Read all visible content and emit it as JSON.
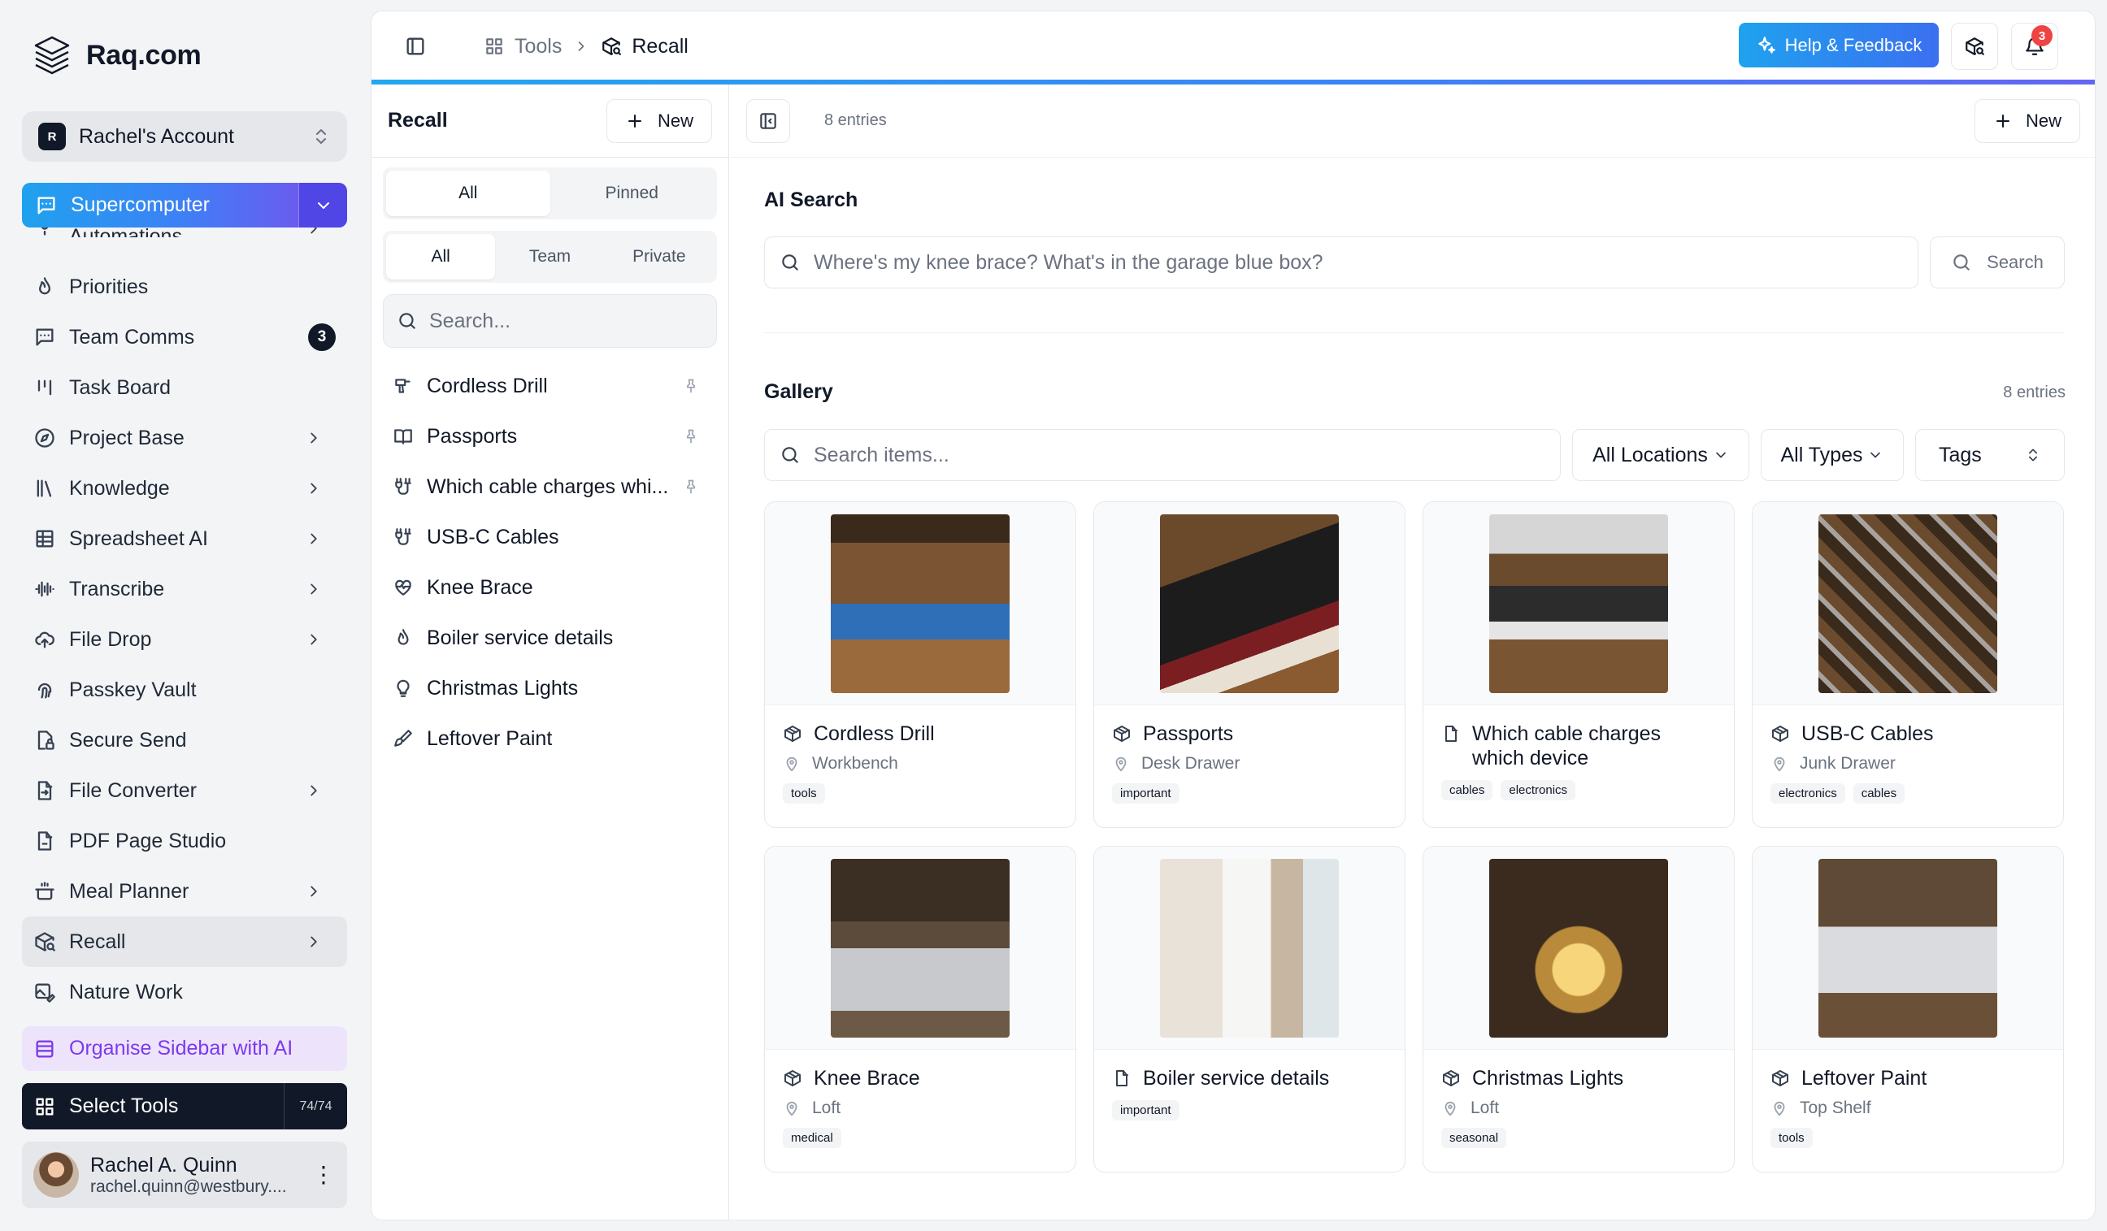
{
  "brand": {
    "name": "Raq.com"
  },
  "account": {
    "badge": "R",
    "name": "Rachel's Account"
  },
  "supercomputer": {
    "label": "Supercomputer"
  },
  "sidebar": {
    "items": [
      {
        "label": "Automations",
        "icon": "automation-icon",
        "chevron": true
      },
      {
        "label": "Priorities",
        "icon": "flame-icon",
        "chevron": false
      },
      {
        "label": "Team Comms",
        "icon": "message-icon",
        "count": "3"
      },
      {
        "label": "Task Board",
        "icon": "kanban-icon",
        "chevron": false
      },
      {
        "label": "Project Base",
        "icon": "compass-icon",
        "chevron": true
      },
      {
        "label": "Knowledge",
        "icon": "library-icon",
        "chevron": true
      },
      {
        "label": "Spreadsheet AI",
        "icon": "grid-icon",
        "chevron": true
      },
      {
        "label": "Transcribe",
        "icon": "waveform-icon",
        "chevron": true
      },
      {
        "label": "File Drop",
        "icon": "cloud-upload-icon",
        "chevron": true
      },
      {
        "label": "Passkey Vault",
        "icon": "fingerprint-icon",
        "chevron": false
      },
      {
        "label": "Secure Send",
        "icon": "file-lock-icon",
        "chevron": false
      },
      {
        "label": "File Converter",
        "icon": "file-convert-icon",
        "chevron": true
      },
      {
        "label": "PDF Page Studio",
        "icon": "file-link-icon",
        "chevron": false
      },
      {
        "label": "Meal Planner",
        "icon": "cooking-pot-icon",
        "chevron": true
      },
      {
        "label": "Recall",
        "icon": "package-search-icon",
        "chevron": true,
        "active": true
      },
      {
        "label": "Nature Work",
        "icon": "image-edit-icon",
        "chevron": false
      }
    ],
    "organise_label": "Organise Sidebar with AI",
    "select_tools_label": "Select Tools",
    "select_tools_count": "74/74"
  },
  "user": {
    "name": "Rachel A. Quinn",
    "email": "rachel.quinn@westbury...."
  },
  "topbar": {
    "crumb_tools": "Tools",
    "crumb_current": "Recall",
    "help_label": "Help & Feedback",
    "notif_count": "3"
  },
  "list": {
    "title": "Recall",
    "new_label": "New",
    "filter1": [
      "All",
      "Pinned"
    ],
    "filter2": [
      "All",
      "Team",
      "Private"
    ],
    "search_placeholder": "Search...",
    "items": [
      {
        "label": "Cordless Drill",
        "icon": "drill-icon",
        "pinned": true
      },
      {
        "label": "Passports",
        "icon": "book-open-icon",
        "pinned": true
      },
      {
        "label": "Which cable charges whi...",
        "icon": "cable-icon",
        "pinned": true
      },
      {
        "label": "USB-C Cables",
        "icon": "cable-icon",
        "pinned": false
      },
      {
        "label": "Knee Brace",
        "icon": "heart-pulse-icon",
        "pinned": false
      },
      {
        "label": "Boiler service details",
        "icon": "flame-icon",
        "pinned": false
      },
      {
        "label": "Christmas Lights",
        "icon": "lightbulb-icon",
        "pinned": false
      },
      {
        "label": "Leftover Paint",
        "icon": "paint-brush-icon",
        "pinned": false
      }
    ]
  },
  "content": {
    "entries": "8 entries",
    "new_label": "New",
    "ai_title": "AI Search",
    "ai_placeholder": "Where's my knee brace? What's in the garage blue box?",
    "ai_search_label": "Search",
    "gallery_title": "Gallery",
    "gallery_entries": "8 entries",
    "gallery_search_placeholder": "Search items...",
    "filter_locations": "All Locations",
    "filter_types": "All Types",
    "filter_tags": "Tags",
    "cards": [
      {
        "title": "Cordless Drill",
        "icon": "package-icon",
        "location": "Workbench",
        "tags": [
          "tools"
        ],
        "img": "drill"
      },
      {
        "title": "Passports",
        "icon": "package-icon",
        "location": "Desk Drawer",
        "tags": [
          "important"
        ],
        "img": "pass"
      },
      {
        "title": "Which cable charges which device",
        "icon": "file-icon",
        "location": "",
        "tags": [
          "cables",
          "electronics"
        ],
        "img": "cable"
      },
      {
        "title": "USB-C Cables",
        "icon": "package-icon",
        "location": "Junk Drawer",
        "tags": [
          "electronics",
          "cables"
        ],
        "img": "usbc"
      },
      {
        "title": "Knee Brace",
        "icon": "package-icon",
        "location": "Loft",
        "tags": [
          "medical"
        ],
        "img": "knee"
      },
      {
        "title": "Boiler service details",
        "icon": "file-icon",
        "location": "",
        "tags": [
          "important"
        ],
        "img": "boiler"
      },
      {
        "title": "Christmas Lights",
        "icon": "package-icon",
        "location": "Loft",
        "tags": [
          "seasonal"
        ],
        "img": "xmas"
      },
      {
        "title": "Leftover Paint",
        "icon": "package-icon",
        "location": "Top Shelf",
        "tags": [
          "tools"
        ],
        "img": "paint"
      }
    ]
  },
  "colors": {
    "accent_blue": "#1fa2ee",
    "accent_indigo": "#4f46e5",
    "purple": "#7c3aed",
    "notif_red": "#ef4444"
  }
}
